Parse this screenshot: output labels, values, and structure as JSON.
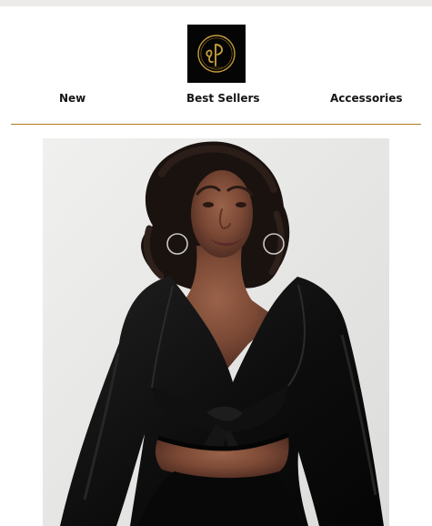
{
  "header": {
    "logo_alt": "dP",
    "logo_icon": "brand-monogram-logo"
  },
  "nav": {
    "items": [
      {
        "label": "New"
      },
      {
        "label": "Best Sellers"
      },
      {
        "label": "Accessories"
      }
    ]
  },
  "colors": {
    "divider": "#b07a16",
    "logo_ring": "#c39a3b",
    "logo_bg": "#050505",
    "nav_text": "#151515"
  },
  "hero": {
    "image_subject": "model-black-tie-front-top"
  }
}
